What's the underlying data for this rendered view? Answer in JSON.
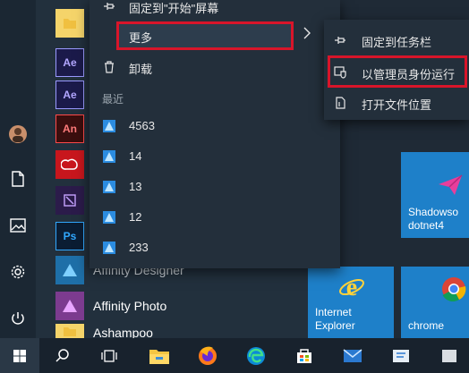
{
  "context_menu": {
    "pin_start": "固定到\"开始\"屏幕",
    "more": "更多",
    "uninstall": "卸载",
    "recent_header": "最近",
    "recent_items": [
      "4563",
      "14",
      "13",
      "12",
      "233"
    ]
  },
  "submenu": {
    "pin_taskbar": "固定到任务栏",
    "run_as_admin": "以管理员身份运行",
    "open_file_location": "打开文件位置"
  },
  "app_list": {
    "affinity_designer": "Affinity Designer",
    "affinity_photo": "Affinity Photo",
    "ashampoo": "Ashampoo",
    "ae_label": "Ae",
    "an_label": "An",
    "ps_label": "Ps"
  },
  "tiles": {
    "shadowsocks": "Shadowso\ndotnet4",
    "ie": "Internet\nExplorer",
    "chrome": "chrome"
  },
  "colors": {
    "highlight_border": "#d8152a",
    "tile_blue": "#1e80c9",
    "menu_bg": "#232f3b"
  }
}
